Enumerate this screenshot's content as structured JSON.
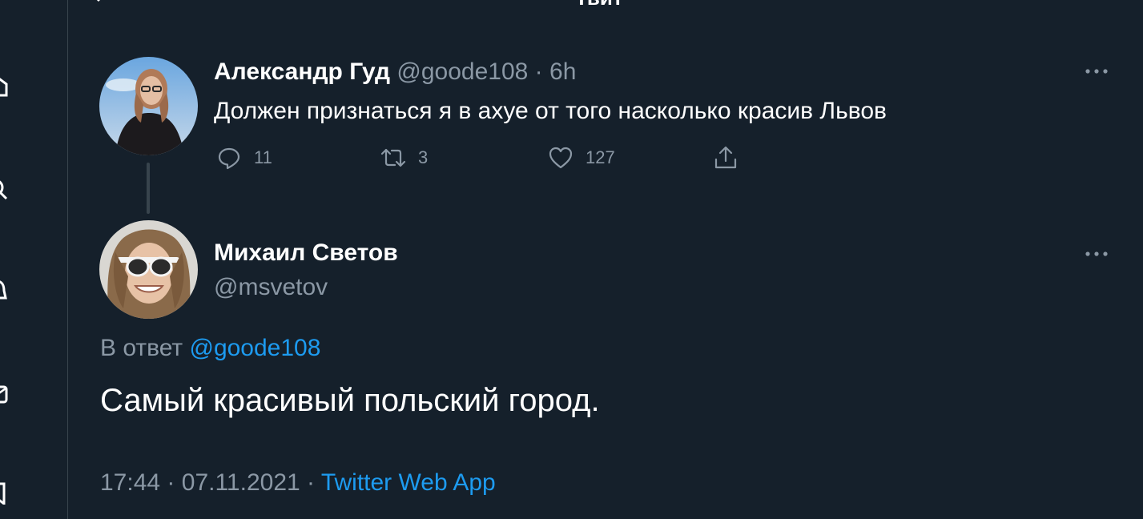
{
  "header": {
    "title": "Твит"
  },
  "parent_tweet": {
    "author_name": "Александр Гуд",
    "handle": "@goode108",
    "separator": "·",
    "time": "6h",
    "text": "Должен признаться я в ахуе от того насколько красив Львов",
    "actions": {
      "replies": "11",
      "retweets": "3",
      "likes": "127"
    }
  },
  "reply_tweet": {
    "author_name": "Михаил Светов",
    "handle": "@msvetov",
    "reply_prefix": "В ответ",
    "reply_to": "@goode108",
    "text": "Самый красивый польский город.",
    "time": "17:44",
    "separator1": "·",
    "date": "07.11.2021",
    "separator2": "·",
    "source": "Twitter Web App"
  },
  "icons": {
    "reply": "speech-bubble-icon",
    "retweet": "retweet-icon",
    "like": "heart-icon",
    "share": "share-icon",
    "more": "more-dots-icon",
    "back": "arrow-left-icon"
  },
  "colors": {
    "background": "#15202b",
    "text": "#ffffff",
    "muted": "#8b98a5",
    "link": "#1d9bf0",
    "divider": "#38444d"
  }
}
